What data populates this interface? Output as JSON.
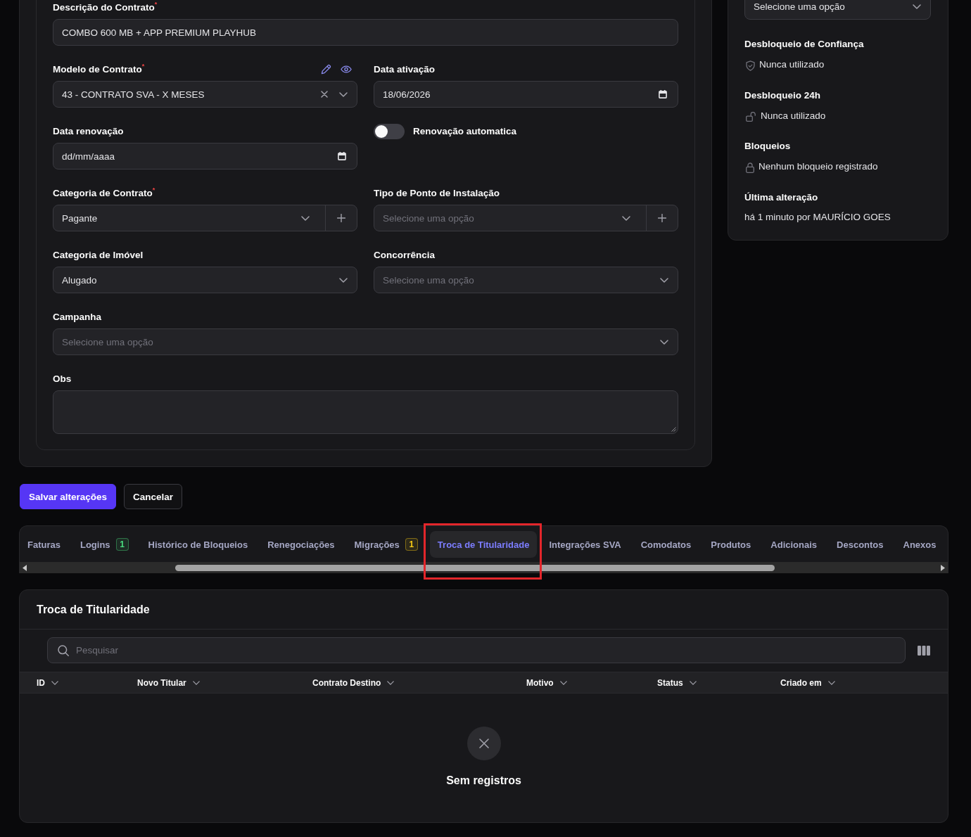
{
  "form": {
    "rows": [
      [
        {
          "kind": "text",
          "label": "Descrição do Contrato$^{*}$",
          "value": "COMBO 600 MB + APP PREMIUM PLAYHUB"
        }
      ],
      [
        {
          "kind": "select",
          "label": "Modelo de Contrato$^{*}$",
          "value": "43 - CONTRATO SVA - X MESES",
          "clearable": true,
          "addable": false,
          "label_actions": true
        },
        {
          "kind": "date",
          "label": "Data ativação",
          "value": "18/06/2026"
        }
      ],
      [
        {
          "kind": "date",
          "label": "Data renovação",
          "placeholder": "dd/mm/aaaa"
        },
        {
          "kind": "toggle",
          "label": "Renovação automatica",
          "on": false
        }
      ],
      [
        {
          "kind": "select",
          "label": "Categoria de Contrato$^{*}$",
          "value": "Pagante",
          "clearable": false,
          "addable": true,
          "label_actions": false
        },
        {
          "kind": "select",
          "label": "Tipo de Ponto de Instalação",
          "placeholder": "Selecione uma opção",
          "clearable": false,
          "addable": true,
          "label_actions": false
        }
      ],
      [
        {
          "kind": "select",
          "label": "Categoria de Imóvel",
          "value": "Alugado",
          "clearable": false,
          "addable": false,
          "label_actions": false
        },
        {
          "kind": "select",
          "label": "Concorrência",
          "placeholder": "Selecione uma opção",
          "clearable": false,
          "addable": false,
          "label_actions": false
        }
      ],
      [
        {
          "kind": "select",
          "label": "Campanha",
          "placeholder": "Selecione uma opção",
          "clearable": false,
          "addable": false,
          "label_actions": false
        }
      ],
      [
        {
          "kind": "textarea",
          "label": "Obs"
        }
      ]
    ]
  },
  "side_panel": {
    "select": {
      "value": "Selecione uma opção"
    },
    "sections": [
      {
        "kind": "trust",
        "title": "Desbloqueio de Confiança",
        "text": "Nunca utilizado"
      },
      {
        "kind": "temporary",
        "title": "Desbloqueio 24h",
        "text": "Nunca utilizado"
      },
      {
        "kind": "blocks",
        "title": "Bloqueios",
        "text": "Nenhum bloqueio registrado"
      },
      {
        "kind": "audit",
        "title": "Última alteração",
        "text": "há 1 minuto por MAURÍCIO GOES"
      }
    ]
  },
  "buttons": [
    {
      "kind": "save",
      "label": "Salvar alterações"
    },
    {
      "kind": "cancel",
      "label": "Cancelar"
    }
  ],
  "tabs": [
    {
      "label": "Faturas",
      "selected": false,
      "highlighted": false
    },
    {
      "label": "Logins",
      "badge": {
        "text": "1",
        "color": "#4ade80"
      },
      "selected": false,
      "highlighted": false
    },
    {
      "label": "Histórico de Bloqueios",
      "selected": false,
      "highlighted": false
    },
    {
      "label": "Renegociações",
      "selected": false,
      "highlighted": false
    },
    {
      "label": "Migrações",
      "badge": {
        "text": "1",
        "color": "#facc15"
      },
      "selected": false,
      "highlighted": false
    },
    {
      "label": "Troca de Titularidade",
      "selected": true,
      "highlighted": true
    },
    {
      "label": "Integrações SVA",
      "selected": false,
      "highlighted": false
    },
    {
      "label": "Comodatos",
      "selected": false,
      "highlighted": false
    },
    {
      "label": "Produtos",
      "selected": false,
      "highlighted": false
    },
    {
      "label": "Adicionais",
      "selected": false,
      "highlighted": false
    },
    {
      "label": "Descontos",
      "selected": false,
      "highlighted": false
    },
    {
      "label": "Anexos",
      "selected": false,
      "highlighted": false
    }
  ],
  "titularity": {
    "title": "Troca de Titularidade",
    "search": {
      "placeholder": "Pesquisar"
    },
    "table": {
      "columns": [
        "ID",
        "Novo Titular",
        "Contrato Destino",
        "Motivo",
        "Status",
        "Criado em"
      ]
    },
    "empty_message": "Sem registros"
  }
}
